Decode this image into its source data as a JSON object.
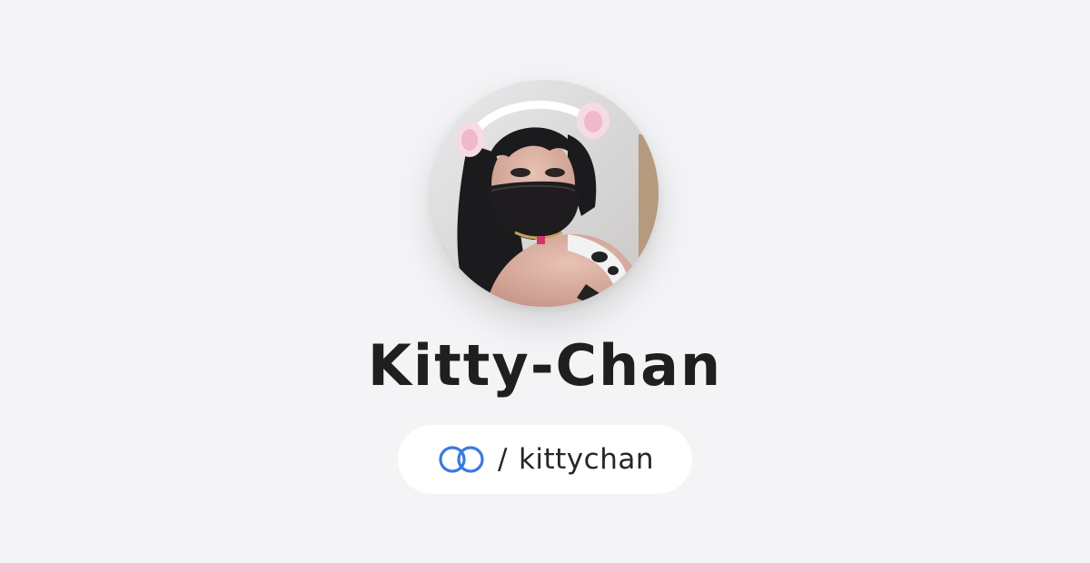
{
  "profile": {
    "display_name": "Kitty-Chan",
    "handle_separator": "/",
    "handle": "kittychan",
    "avatar_alt": "profile-photo",
    "logo_icon": "linked-rings-logo-icon"
  },
  "colors": {
    "background": "#f4f4f6",
    "pill_background": "#ffffff",
    "accent_logo": "#3b7be0",
    "bottom_bar": "#f8c5d6",
    "text": "#1f1f1f"
  }
}
